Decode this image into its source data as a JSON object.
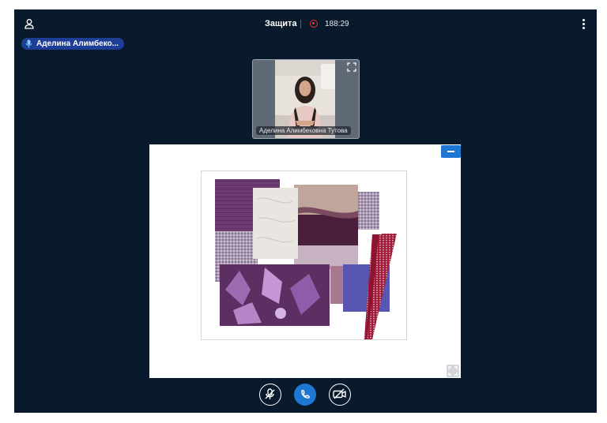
{
  "header": {
    "title": "Защита",
    "timer": "188:29",
    "recording": true,
    "user_icon": "user-icon",
    "menu_icon": "kebab-menu-icon"
  },
  "active_speaker": {
    "name": "Аделина Алимбеко...",
    "icon": "microphone-icon"
  },
  "participant_video": {
    "caption": "Аделина Алимбековна Тутова",
    "expand_icon": "expand-icon"
  },
  "screen_share": {
    "content": "moodboard-image",
    "minimize_icon": "minus-icon",
    "fullscreen_icon": "fullscreen-icon"
  },
  "controls": {
    "mic_icon": "microphone-muted-icon",
    "end_icon": "phone-icon",
    "camera_icon": "camera-off-icon"
  },
  "colors": {
    "background": "#0a1a2d",
    "accent": "#1f77d4",
    "speaker_badge": "#1e3d97",
    "record": "#e33333"
  }
}
